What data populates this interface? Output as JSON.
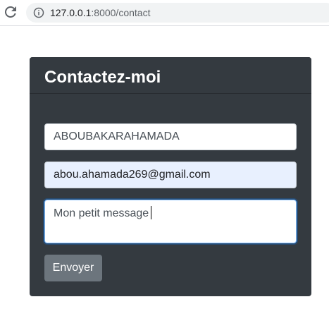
{
  "browser": {
    "url_host": "127.0.0.1",
    "url_path": ":8000/contact",
    "reload_icon": "reload-icon",
    "info_icon": "info-icon"
  },
  "contact_card": {
    "title": "Contactez-moi",
    "name_value": "ABOUBAKARAHAMADA",
    "email_value": "abou.ahamada269@gmail.com",
    "message_value": "Mon petit message",
    "submit_label": "Envoyer"
  },
  "colors": {
    "card_background": "#343a40",
    "button_background": "#6c757d",
    "autofill_background": "#e8f0fe",
    "focus_border": "#80bdff"
  }
}
